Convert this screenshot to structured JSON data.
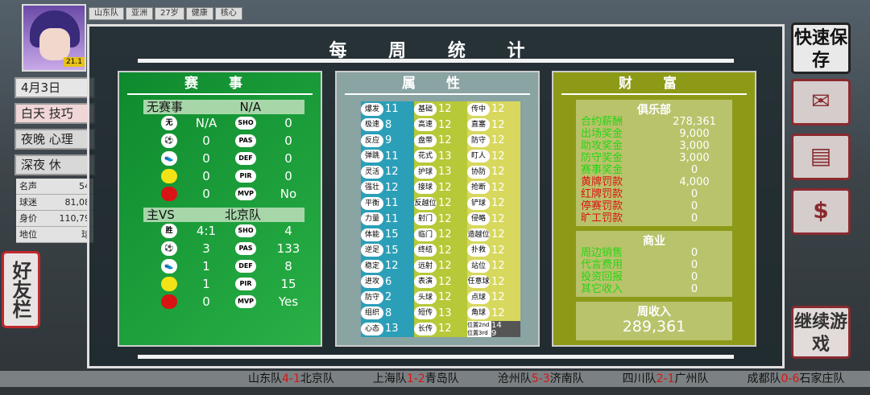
{
  "hud": {
    "team": "山东队",
    "region": "亚洲",
    "age": "27岁",
    "health": "健康",
    "role": "核心",
    "level_badge": "21.1",
    "date": "4月3日",
    "day_label": "白天",
    "day_val": "技巧",
    "night_label": "夜晚",
    "night_val": "心理",
    "late_label": "深夜",
    "late_val": "休",
    "stats": [
      {
        "k": "名声",
        "v": "54"
      },
      {
        "k": "球迷",
        "v": "81,08"
      },
      {
        "k": "身价",
        "v": "110,79"
      },
      {
        "k": "地位",
        "v": "球"
      }
    ],
    "friends": "好友栏"
  },
  "buttons": {
    "quick_save": "快速保存",
    "continue": "继续游戏",
    "mail_icon": "envelope-icon",
    "shop_icon": "register-icon",
    "money_icon": "dollar-icon"
  },
  "title": "每 周 统 计",
  "match": {
    "header": "赛 事",
    "m1": {
      "label": "无赛事",
      "opp": "N/A",
      "rows": [
        {
          "i1": "无",
          "v1": "N/A",
          "i2": "SHO",
          "v2": "0"
        },
        {
          "i1": "⚽",
          "v1": "0",
          "i2": "PAS",
          "v2": "0"
        },
        {
          "i1": "👟",
          "v1": "0",
          "i2": "DEF",
          "v2": "0"
        },
        {
          "i1": "",
          "v1": "0",
          "i2": "PIR",
          "v2": "0",
          "c": "yellow"
        },
        {
          "i1": "",
          "v1": "0",
          "i2": "MVP",
          "v2": "No",
          "c": "red"
        }
      ]
    },
    "m2": {
      "label": "主VS",
      "opp": "北京队",
      "rows": [
        {
          "i1": "胜",
          "v1": "4:1",
          "i2": "SHO",
          "v2": "4"
        },
        {
          "i1": "⚽",
          "v1": "3",
          "i2": "PAS",
          "v2": "133"
        },
        {
          "i1": "👟",
          "v1": "1",
          "i2": "DEF",
          "v2": "8"
        },
        {
          "i1": "",
          "v1": "1",
          "i2": "PIR",
          "v2": "15",
          "c": "yellow"
        },
        {
          "i1": "",
          "v1": "0",
          "i2": "MVP",
          "v2": "Yes",
          "c": "red"
        }
      ]
    }
  },
  "attr": {
    "header": "属 性",
    "colA": [
      [
        "爆发",
        "11"
      ],
      [
        "极速",
        "8"
      ],
      [
        "反应",
        "9"
      ],
      [
        "弹跳",
        "11"
      ],
      [
        "灵活",
        "12"
      ],
      [
        "强壮",
        "12"
      ],
      [
        "平衡",
        "11"
      ],
      [
        "力量",
        "11"
      ],
      [
        "体能",
        "15"
      ],
      [
        "逆足",
        "15"
      ],
      [
        "稳定",
        "12"
      ],
      [
        "进攻",
        "6"
      ],
      [
        "防守",
        "2"
      ],
      [
        "组织",
        "8"
      ],
      [
        "心态",
        "13"
      ]
    ],
    "colB": [
      [
        "基础",
        "12"
      ],
      [
        "高速",
        "12"
      ],
      [
        "盘带",
        "12"
      ],
      [
        "花式",
        "13"
      ],
      [
        "护球",
        "13"
      ],
      [
        "接球",
        "12"
      ],
      [
        "反越位",
        "12"
      ],
      [
        "射门",
        "12"
      ],
      [
        "临门",
        "12"
      ],
      [
        "终结",
        "12"
      ],
      [
        "远射",
        "12"
      ],
      [
        "表演",
        "12"
      ],
      [
        "头球",
        "12"
      ],
      [
        "短传",
        "13"
      ],
      [
        "长传",
        "12"
      ]
    ],
    "colC": [
      [
        "传中",
        "12"
      ],
      [
        "直塞",
        "12"
      ],
      [
        "防守",
        "12"
      ],
      [
        "盯人",
        "12"
      ],
      [
        "协防",
        "12"
      ],
      [
        "抢断",
        "12"
      ],
      [
        "铲球",
        "12"
      ],
      [
        "侵略",
        "12"
      ],
      [
        "造越位",
        "12"
      ],
      [
        "扑救",
        "12"
      ],
      [
        "站位",
        "12"
      ],
      [
        "任意球",
        "12"
      ],
      [
        "点球",
        "12"
      ],
      [
        "角球",
        "12"
      ]
    ],
    "pos": [
      {
        "k": "位置2nd",
        "v": "14"
      },
      {
        "k": "位置3rd",
        "v": "9"
      }
    ]
  },
  "money": {
    "header": "财 富",
    "club": {
      "title": "俱乐部",
      "rows": [
        {
          "n": "合约薪酬",
          "a": "278,361",
          "c": "green"
        },
        {
          "n": "出场奖金",
          "a": "9,000",
          "c": "green"
        },
        {
          "n": "助攻奖金",
          "a": "3,000",
          "c": "green"
        },
        {
          "n": "防守奖金",
          "a": "3,000",
          "c": "green"
        },
        {
          "n": "赛事奖金",
          "a": "0",
          "c": "green"
        },
        {
          "n": "黄牌罚款",
          "a": "4,000",
          "c": "redt"
        },
        {
          "n": "红牌罚款",
          "a": "0",
          "c": "redt"
        },
        {
          "n": "停赛罚款",
          "a": "0",
          "c": "redt"
        },
        {
          "n": "旷工罚款",
          "a": "0",
          "c": "redt"
        }
      ]
    },
    "biz": {
      "title": "商业",
      "rows": [
        {
          "n": "周边销售",
          "a": "0"
        },
        {
          "n": "代言费用",
          "a": "0"
        },
        {
          "n": "投资回报",
          "a": "0"
        },
        {
          "n": "其它收入",
          "a": "0"
        }
      ]
    },
    "income_label": "周收入",
    "income": "289,361"
  },
  "ticker": [
    {
      "h": "山东队",
      "s": "4-1",
      "a": "北京队"
    },
    {
      "h": "上海队",
      "s": "1-2",
      "a": "青岛队"
    },
    {
      "h": "沧州队",
      "s": "5-3",
      "a": "济南队"
    },
    {
      "h": "四川队",
      "s": "2-1",
      "a": "广州队"
    },
    {
      "h": "成都队",
      "s": "0-6",
      "a": "石家庄队"
    }
  ]
}
